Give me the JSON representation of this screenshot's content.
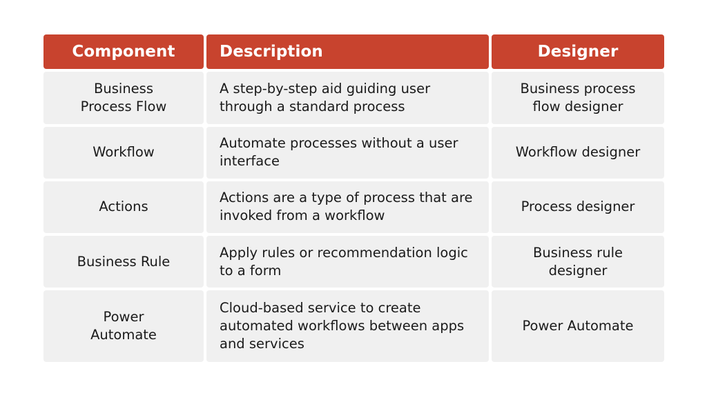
{
  "table": {
    "accent_color": "#c8432e",
    "header_text_color": "#ffffff",
    "cell_background": "#f0f0f0",
    "cell_text_color": "#1a1a1a",
    "page_background": "#ffffff",
    "headers": {
      "component": "Component",
      "description": "Description",
      "designer": "Designer"
    },
    "rows": [
      {
        "component": "Business\nProcess Flow",
        "description": "A step-by-step aid guiding user through a standard process",
        "designer": "Business process\nflow designer"
      },
      {
        "component": "Workflow",
        "description": "Automate processes without a user interface",
        "designer": "Workflow designer"
      },
      {
        "component": "Actions",
        "description": "Actions are a type of process that are invoked from a workflow",
        "designer": "Process designer"
      },
      {
        "component": "Business Rule",
        "description": "Apply rules or recommendation logic to a form",
        "designer": "Business rule\ndesigner"
      },
      {
        "component": "Power\nAutomate",
        "description": "Cloud-based service to create automated workflows between apps and services",
        "designer": "Power Automate"
      }
    ]
  }
}
